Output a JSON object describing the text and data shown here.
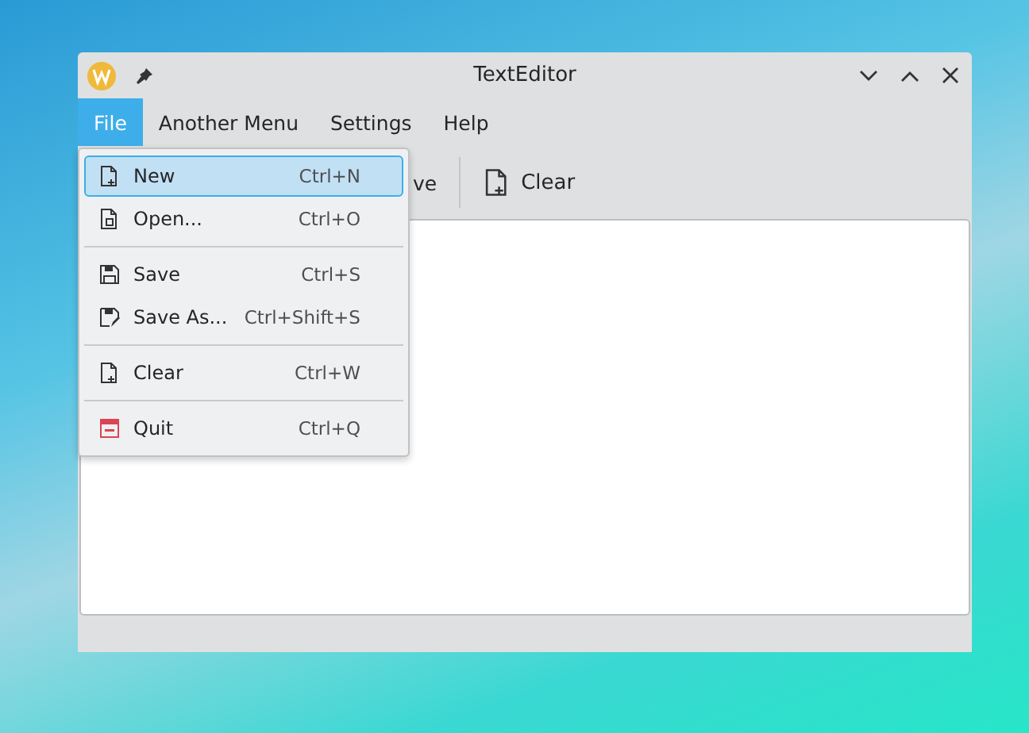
{
  "window": {
    "title": "TextEditor"
  },
  "menubar": [
    {
      "label": "File",
      "selected": true
    },
    {
      "label": "Another Menu",
      "selected": false
    },
    {
      "label": "Settings",
      "selected": false
    },
    {
      "label": "Help",
      "selected": false
    }
  ],
  "toolbar": [
    {
      "kind": "partial",
      "label": "ve"
    },
    {
      "kind": "separator"
    },
    {
      "kind": "button",
      "label": "Clear"
    }
  ],
  "file_menu": [
    {
      "kind": "item",
      "label": "New",
      "shortcut": "Ctrl+N",
      "selected": true
    },
    {
      "kind": "item",
      "label": "Open...",
      "shortcut": "Ctrl+O",
      "selected": false
    },
    {
      "kind": "separator"
    },
    {
      "kind": "item",
      "label": "Save",
      "shortcut": "Ctrl+S",
      "selected": false
    },
    {
      "kind": "item",
      "label": "Save As...",
      "shortcut": "Ctrl+Shift+S",
      "selected": false
    },
    {
      "kind": "separator"
    },
    {
      "kind": "item",
      "label": "Clear",
      "shortcut": "Ctrl+W",
      "selected": false
    },
    {
      "kind": "separator"
    },
    {
      "kind": "item",
      "label": "Quit",
      "shortcut": "Ctrl+Q",
      "selected": false
    }
  ]
}
